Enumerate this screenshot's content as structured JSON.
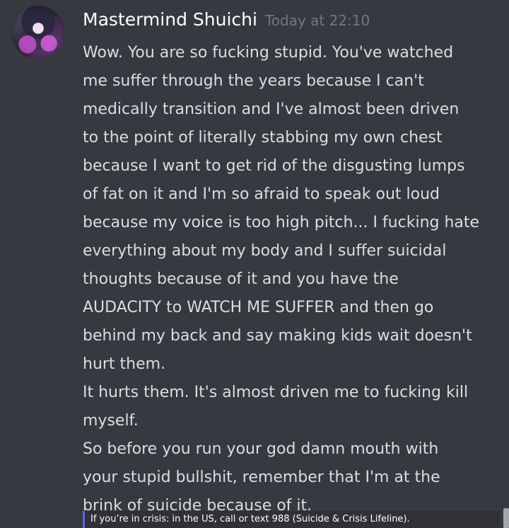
{
  "message": {
    "author": "Mastermind Shuichi",
    "timestamp": "Today at 22:10",
    "lines": [
      "Wow. You are so fucking stupid. You've watched",
      "me suffer through the years because I can't",
      "medically transition and I've almost been driven",
      "to the point of literally stabbing my own chest",
      "because I want to get rid of the disgusting lumps",
      "of fat on it and I'm so afraid to speak out loud",
      "because my voice is too high pitch... I fucking hate",
      "everything about my body and I suffer suicidal",
      "thoughts because of it and you have the",
      "AUDACITY to WATCH ME SUFFER and then go",
      "behind my back and say making kids wait doesn't",
      "hurt them.",
      "It hurts them. It's almost driven me to fucking kill",
      "myself.",
      "So before you run your god damn mouth with",
      "your stupid bullshit, remember that I'm at the",
      "brink of suicide because of it."
    ]
  },
  "support": {
    "text": "If you’re in crisis: in the US, call or text 988 (Suicide & Crisis Lifeline)."
  },
  "colors": {
    "background": "#36393f",
    "username": "#ffffff",
    "timestamp": "#72767d",
    "message_text": "#dcddde",
    "accent": "#5865f2"
  }
}
